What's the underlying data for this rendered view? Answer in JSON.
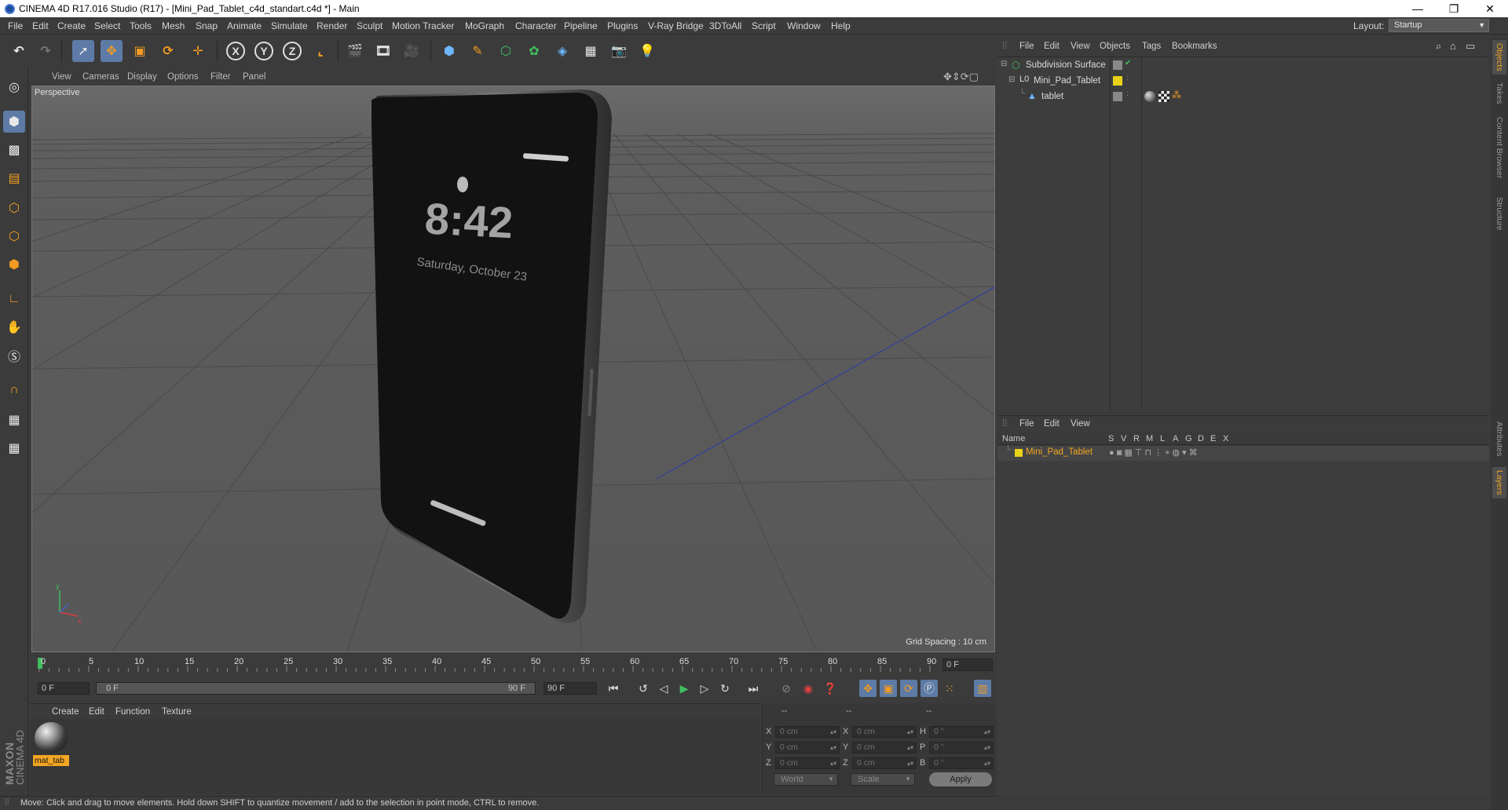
{
  "window": {
    "title": "CINEMA 4D R17.016 Studio (R17) - [Mini_Pad_Tablet_c4d_standart.c4d *] - Main",
    "minimize": "—",
    "maximize": "❐",
    "close": "✕"
  },
  "menu": [
    "File",
    "Edit",
    "Create",
    "Select",
    "Tools",
    "Mesh",
    "Snap",
    "Animate",
    "Simulate",
    "Render",
    "Sculpt",
    "Motion Tracker",
    "MoGraph",
    "Character",
    "Pipeline",
    "Plugins",
    "V-Ray Bridge",
    "3DToAll",
    "Script",
    "Window",
    "Help"
  ],
  "layout": {
    "label": "Layout:",
    "value": "Startup"
  },
  "viewport": {
    "menu": [
      "View",
      "Cameras",
      "Display",
      "Options",
      "Filter",
      "Panel"
    ],
    "label": "Perspective",
    "grid_spacing": "Grid Spacing : 10 cm",
    "screen_time": "8:42",
    "screen_date": "Saturday, October 23",
    "axis_y": "y",
    "axis_x": "x"
  },
  "timeline": {
    "ticks": [
      "0",
      "5",
      "10",
      "15",
      "20",
      "25",
      "30",
      "35",
      "40",
      "45",
      "50",
      "55",
      "60",
      "65",
      "70",
      "75",
      "80",
      "85",
      "90"
    ],
    "current_frame": "0 F",
    "start": "0 F",
    "range_start": "0 F",
    "range_end": "90 F",
    "end": "90 F"
  },
  "material_manager": {
    "menu": [
      "Create",
      "Edit",
      "Function",
      "Texture"
    ],
    "material_name": "mat_tab"
  },
  "coordinates": {
    "headers": [
      "--",
      "--",
      "--"
    ],
    "rows": [
      {
        "l1": "X",
        "v1": "0 cm",
        "l2": "X",
        "v2": "0 cm",
        "l3": "H",
        "v3": "0 °"
      },
      {
        "l1": "Y",
        "v1": "0 cm",
        "l2": "Y",
        "v2": "0 cm",
        "l3": "P",
        "v3": "0 °"
      },
      {
        "l1": "Z",
        "v1": "0 cm",
        "l2": "Z",
        "v2": "0 cm",
        "l3": "B",
        "v3": "0 °"
      }
    ],
    "mode1": "World",
    "mode2": "Scale",
    "apply": "Apply"
  },
  "status": "Move: Click and drag to move elements. Hold down SHIFT to quantize movement / add to the selection in point mode, CTRL to remove.",
  "logo": {
    "maxon": "MAXON",
    "cinema": "CINEMA 4D"
  },
  "object_manager": {
    "menu": [
      "File",
      "Edit",
      "View",
      "Objects",
      "Tags",
      "Bookmarks"
    ],
    "objects": [
      {
        "name": "Subdivision Surface"
      },
      {
        "name": "Mini_Pad_Tablet"
      },
      {
        "name": "tablet"
      }
    ]
  },
  "layer_manager": {
    "menu": [
      "File",
      "Edit",
      "View"
    ],
    "columns": [
      "Name",
      "S",
      "V",
      "R",
      "M",
      "L",
      "A",
      "G",
      "D",
      "E",
      "X"
    ],
    "layers": [
      {
        "name": "Mini_Pad_Tablet",
        "color": "#e8d21a"
      }
    ]
  },
  "right_tabs": [
    "Objects",
    "Takes",
    "Content Browser",
    "Structure",
    "Attributes",
    "Layers"
  ],
  "colors": {
    "accent": "#f2a623",
    "selection": "#5d7ba6",
    "layer_yellow": "#e8d21a",
    "object_green": "#3fbf5f"
  }
}
